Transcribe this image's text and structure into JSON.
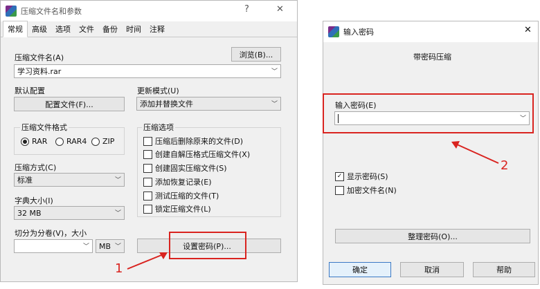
{
  "left_window": {
    "title": "压缩文件名和参数",
    "tabs": [
      "常规",
      "高级",
      "选项",
      "文件",
      "备份",
      "时间",
      "注释"
    ],
    "archive_name_label": "压缩文件名(A)",
    "browse_button": "浏览(B)...",
    "archive_name_value": "学习资料.rar",
    "default_profile_label": "默认配置",
    "profile_button": "配置文件(F)...",
    "update_mode_label": "更新模式(U)",
    "update_mode_value": "添加并替换文件",
    "format_group_label": "压缩文件格式",
    "format_options": [
      "RAR",
      "RAR4",
      "ZIP"
    ],
    "format_selected": "RAR",
    "options_group_label": "压缩选项",
    "options": [
      "压缩后删除原来的文件(D)",
      "创建自解压格式压缩文件(X)",
      "创建固实压缩文件(S)",
      "添加恢复记录(E)",
      "测试压缩的文件(T)",
      "锁定压缩文件(L)"
    ],
    "method_label": "压缩方式(C)",
    "method_value": "标准",
    "dict_label": "字典大小(I)",
    "dict_value": "32 MB",
    "split_label": "切分为分卷(V)，大小",
    "split_unit": "MB",
    "set_password_button": "设置密码(P)..."
  },
  "right_window": {
    "title": "输入密码",
    "heading": "带密码压缩",
    "password_label": "输入密码(E)",
    "password_value": "",
    "show_password_label": "显示密码(S)",
    "show_password_checked": true,
    "encrypt_names_label": "加密文件名(N)",
    "encrypt_names_checked": false,
    "organize_button": "整理密码(O)...",
    "ok_button": "确定",
    "cancel_button": "取消",
    "help_button": "帮助"
  },
  "annotations": {
    "step1": "1",
    "step2": "2",
    "accent": "#d9231f"
  }
}
